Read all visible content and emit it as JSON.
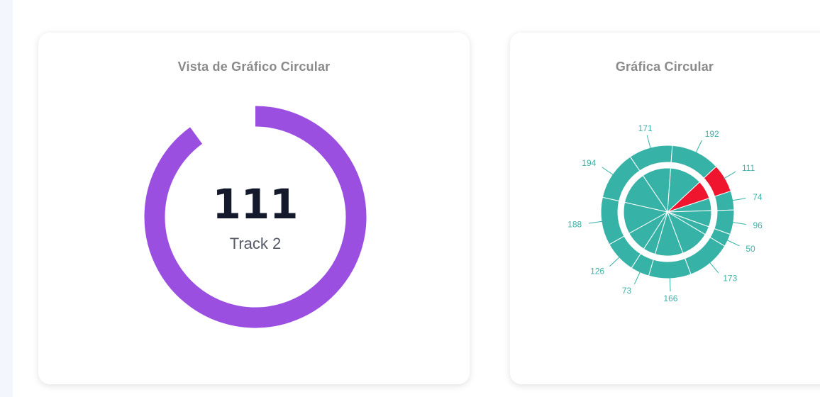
{
  "left_card": {
    "title": "Vista de Gráfico Circular"
  },
  "right_card": {
    "title": "Gráfica Circular"
  },
  "colors": {
    "arc": "#9b4fe0",
    "teal": "#36b2a6",
    "highlight": "#f0152f",
    "title": "#8a8a8a"
  },
  "chart_data": [
    {
      "type": "radial-progress",
      "title": "Vista de Gráfico Circular",
      "value": 111,
      "label": "Track 2",
      "progress_fraction": 0.9
    },
    {
      "type": "pie",
      "title": "Gráfica Circular",
      "values": [
        111,
        74,
        96,
        50,
        173,
        166,
        73,
        126,
        188,
        194,
        171,
        192
      ],
      "labels": [
        "111",
        "74",
        "96",
        "50",
        "173",
        "166",
        "73",
        "126",
        "188",
        "194",
        "171",
        "192"
      ],
      "highlighted_index": 0
    }
  ]
}
